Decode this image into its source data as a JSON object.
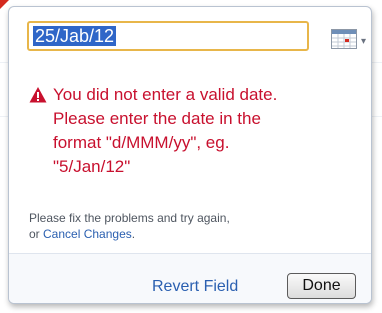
{
  "date_field": {
    "value": "25/Jab/12"
  },
  "icons": {
    "calendar": "calendar-icon",
    "warning": "warning-triangle-icon",
    "dropdown": "dropdown-arrow-icon"
  },
  "error": {
    "lines": [
      "You did not enter a valid date.",
      "Please enter the date in the",
      "format \"d/MMM/yy\", eg.",
      "\"5/Jan/12\""
    ]
  },
  "help": {
    "prefix_line1": "Please fix the problems and try again,",
    "prefix_line2": "or ",
    "cancel_link": "Cancel Changes",
    "suffix": "."
  },
  "footer": {
    "revert_label": "Revert Field",
    "done_label": "Done"
  },
  "colors": {
    "error": "#c8102e",
    "link": "#2a5fb0",
    "input_focus_border": "#e8b64a",
    "selection": "#2f66c8"
  }
}
